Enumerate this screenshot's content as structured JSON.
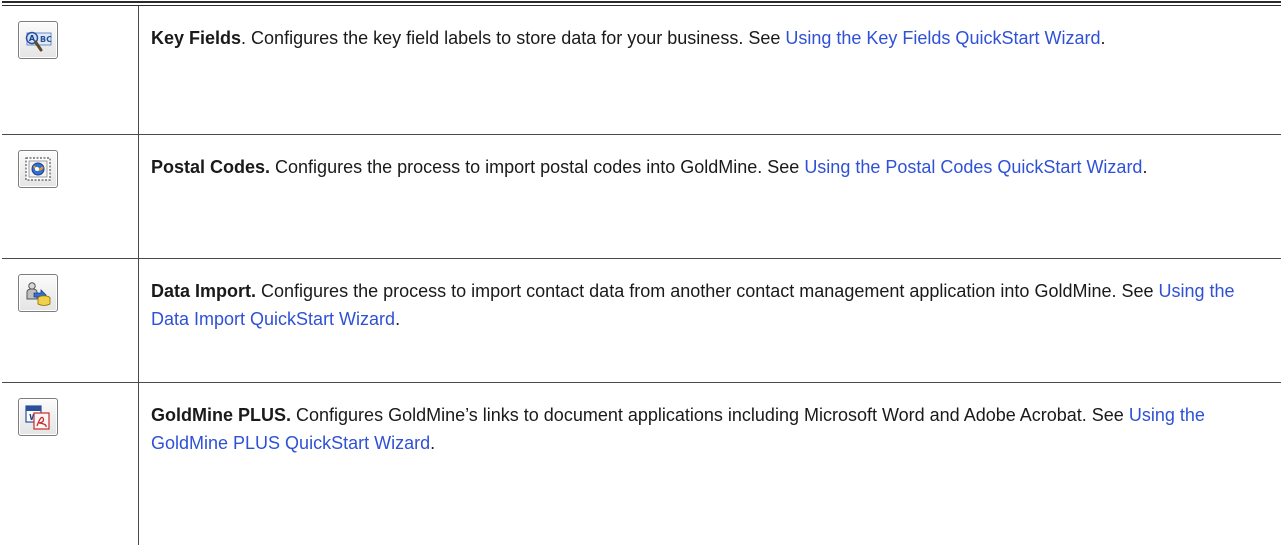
{
  "rows": [
    {
      "icon": "key-fields-icon",
      "term": "Key Fields",
      "after_term": ". Configures the key field labels to store data for your business. See ",
      "link": "Using the Key Fields QuickStart Wizard",
      "tail": "."
    },
    {
      "icon": "postal-codes-icon",
      "term": "Postal Codes.",
      "after_term": " Configures the process to import postal codes into GoldMine. See ",
      "link": "Using the Postal Codes QuickStart Wizard",
      "tail": "."
    },
    {
      "icon": "data-import-icon",
      "term": "Data Import.",
      "after_term": " Configures the process to import contact data from another contact management application into GoldMine. See ",
      "link": "Using the Data Import QuickStart Wizard",
      "tail": "."
    },
    {
      "icon": "goldmine-plus-icon",
      "term": "GoldMine PLUS.",
      "after_term": " Configures GoldMine’s links to document applications including Microsoft Word and Adobe Acrobat. See ",
      "link": "Using the GoldMine PLUS QuickStart Wizard",
      "tail": "."
    }
  ],
  "colors": {
    "link": "#2f51d6",
    "border": "#4a4a4a"
  }
}
